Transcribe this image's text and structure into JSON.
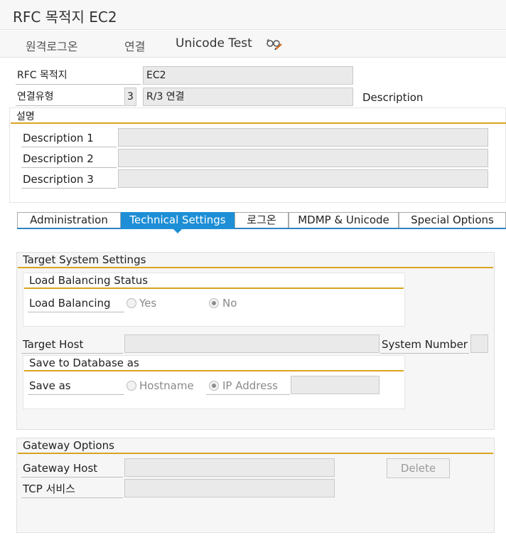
{
  "window": {
    "title": "RFC 목적지 EC2"
  },
  "toolbar": {
    "remote_logon": "원격로그온",
    "connect": "연결",
    "unicode_test": "Unicode Test"
  },
  "header": {
    "rfc_dest_label": "RFC 목적지",
    "rfc_dest_value": "EC2",
    "conn_type_label": "연결유형",
    "conn_type_code": "3",
    "conn_type_value": "R/3 연결",
    "description_label": "Description"
  },
  "desc_section": {
    "title": "설명",
    "rows": [
      {
        "label": "Description 1",
        "value": ""
      },
      {
        "label": "Description 2",
        "value": ""
      },
      {
        "label": "Description 3",
        "value": ""
      }
    ]
  },
  "tabs": [
    {
      "label": "Administration",
      "active": false
    },
    {
      "label": "Technical Settings",
      "active": true
    },
    {
      "label": "로그온",
      "active": false
    },
    {
      "label": "MDMP & Unicode",
      "active": false
    },
    {
      "label": "Special Options",
      "active": false
    }
  ],
  "target": {
    "title": "Target System Settings",
    "lb_title": "Load Balancing Status",
    "lb_label": "Load Balancing",
    "lb_yes": "Yes",
    "lb_no": "No",
    "lb_selected": "No",
    "host_label": "Target Host",
    "host_value": "",
    "sysnum_label": "System Number",
    "sysnum_value": "",
    "save_title": "Save to Database as",
    "save_label": "Save as",
    "save_hostname": "Hostname",
    "save_ip": "IP Address",
    "save_selected": "IP Address",
    "ip_value": ""
  },
  "gateway": {
    "title": "Gateway Options",
    "host_label": "Gateway Host",
    "host_value": "",
    "tcp_label": "TCP 서비스",
    "tcp_value": "",
    "delete_label": "Delete"
  },
  "icons": {
    "unicode_test_icon": "glasses-pencil-icon"
  }
}
